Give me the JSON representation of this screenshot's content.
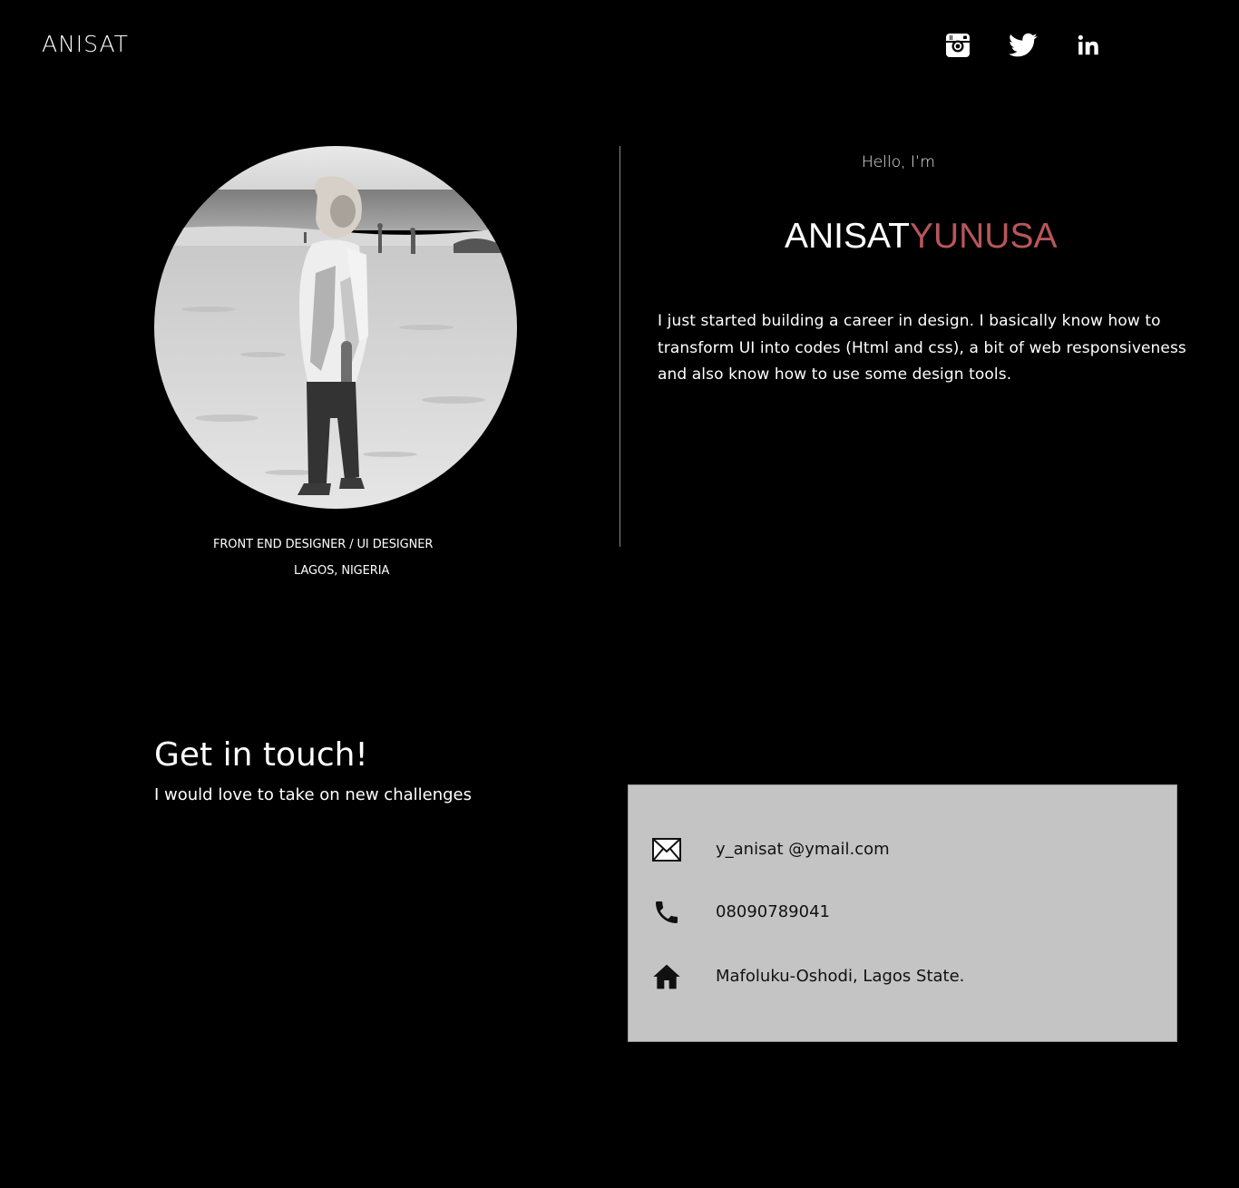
{
  "header": {
    "logo_text": "ANISAT",
    "social": [
      {
        "name": "instagram",
        "icon": "instagram-icon"
      },
      {
        "name": "twitter",
        "icon": "twitter-icon"
      },
      {
        "name": "linkedin",
        "icon": "linkedin-icon"
      }
    ]
  },
  "profile": {
    "role": "FRONT END DESIGNER / UI DESIGNER",
    "location": "LAGOS, NIGERIA"
  },
  "intro": {
    "greeting": "Hello, I’m",
    "first_name": "ANISAT",
    "last_name": "YUNUSA",
    "bio": " I just started building a career  in design. I basically know how to transform UI into codes (Html and css), a bit of web responsiveness and also know how to use some design tools."
  },
  "contact": {
    "title": "Get in touch!",
    "subtitle": "I would love to take on new challenges",
    "email": "y_anisat @ymail.com",
    "phone": "08090789041",
    "address": "Mafoluku-Oshodi, Lagos State."
  },
  "colors": {
    "background": "#000000",
    "accent": "#b7565c",
    "card": "#c4c4c4"
  }
}
